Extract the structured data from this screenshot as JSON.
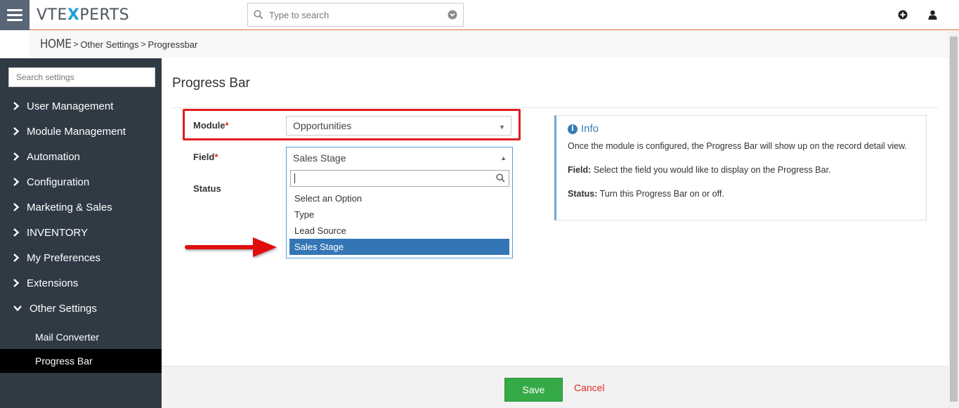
{
  "topbar": {
    "logo_left": "VTE",
    "logo_x": "X",
    "logo_right": "PERTS",
    "search_placeholder": "Type to search",
    "icons": [
      "plus-circle-icon",
      "user-icon"
    ],
    "accent_color": "#e06a2e"
  },
  "breadcrumb": {
    "home": "HOME",
    "separator": ">",
    "items": [
      "Other Settings",
      "Progressbar"
    ]
  },
  "sidebar": {
    "search_placeholder": "Search settings",
    "items": [
      {
        "label": "User Management",
        "expanded": false
      },
      {
        "label": "Module Management",
        "expanded": false
      },
      {
        "label": "Automation",
        "expanded": false
      },
      {
        "label": "Configuration",
        "expanded": false
      },
      {
        "label": "Marketing & Sales",
        "expanded": false
      },
      {
        "label": "INVENTORY",
        "expanded": false
      },
      {
        "label": "My Preferences",
        "expanded": false
      },
      {
        "label": "Extensions",
        "expanded": false
      },
      {
        "label": "Other Settings",
        "expanded": true
      }
    ],
    "subitems": [
      {
        "label": "Mail Converter",
        "active": false
      },
      {
        "label": "Progress Bar",
        "active": true
      }
    ]
  },
  "main": {
    "title": "Progress Bar",
    "module_label": "Module",
    "module_value": "Opportunities",
    "field_label": "Field",
    "field_value": "Sales Stage",
    "status_label": "Status",
    "required_mark": "*",
    "dropdown_options": [
      "Select an Option",
      "Type",
      "Lead Source",
      "Sales Stage"
    ],
    "dropdown_selected": "Sales Stage"
  },
  "info": {
    "title": "Info",
    "intro": "Once the module is configured, the Progress Bar will show up on the record detail view.",
    "field_term": "Field:",
    "field_desc": "Select the field you would like to display on the Progress Bar.",
    "status_term": "Status:",
    "status_desc": "Turn this Progress Bar on or off."
  },
  "footer": {
    "save_label": "Save",
    "cancel_label": "Cancel"
  }
}
